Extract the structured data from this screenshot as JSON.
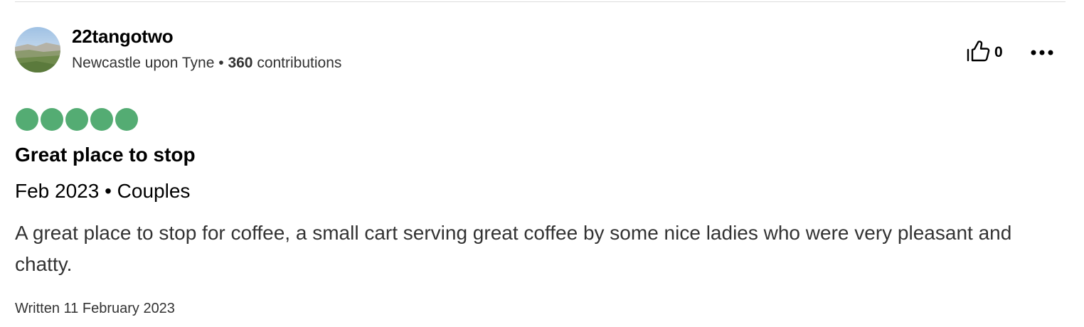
{
  "review": {
    "user": {
      "name": "22tangotwo",
      "location": "Newcastle upon Tyne",
      "separator": " • ",
      "contributions_count": "360",
      "contributions_label": " contributions",
      "avatar": "avatar-photo"
    },
    "actions": {
      "helpful_icon": "thumbs-up-icon",
      "helpful_count": "0",
      "more_icon": "more-options-icon"
    },
    "rating": {
      "value": 5,
      "max": 5,
      "color": "#54ac73"
    },
    "title": "Great place to stop",
    "trip_info": "Feb 2023 • Couples",
    "text": "A great place to stop for coffee, a small cart serving great coffee by some nice ladies who were very pleasant and chatty.",
    "written_date": "Written 11 February 2023"
  }
}
